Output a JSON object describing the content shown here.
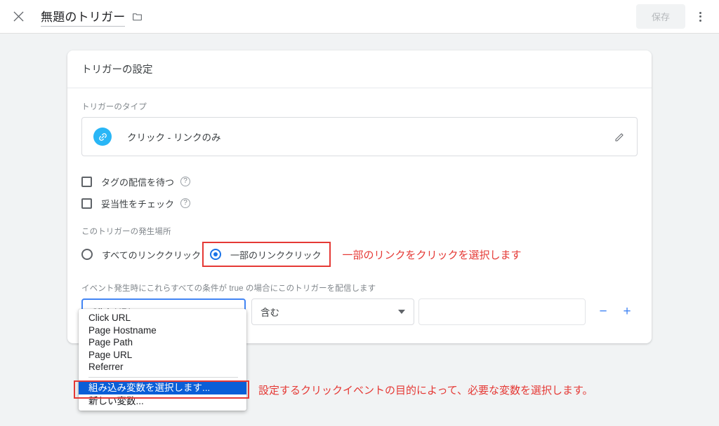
{
  "appbar": {
    "close_icon": "close-icon",
    "title": "無題のトリガー",
    "folder_icon": "folder-icon",
    "save_label": "保存",
    "overflow_icon": "more-vert-icon"
  },
  "card": {
    "heading": "トリガーの設定",
    "trigger_type": {
      "label": "トリガーのタイプ",
      "icon": "link-icon",
      "value": "クリック - リンクのみ",
      "edit_icon": "pencil-icon"
    },
    "checkboxes": [
      {
        "label": "タグの配信を待つ",
        "checked": false,
        "help_icon": "help-circle-icon"
      },
      {
        "label": "妥当性をチェック",
        "checked": false,
        "help_icon": "help-circle-icon"
      }
    ],
    "fire_on": {
      "label": "このトリガーの発生場所",
      "options": [
        {
          "label": "すべてのリンククリック",
          "selected": false
        },
        {
          "label": "一部のリンククリック",
          "selected": true
        }
      ]
    },
    "conditions": {
      "label": "イベント発生時にこれらすべての条件が true の場合にこのトリガーを配信します",
      "variable_value": "Click URL",
      "operator_value": "含む",
      "value_field": "",
      "remove_label": "−",
      "add_label": "+"
    }
  },
  "dropdown": {
    "items": [
      {
        "label": "Click URL",
        "selected": false
      },
      {
        "label": "Page Hostname",
        "selected": false
      },
      {
        "label": "Page Path",
        "selected": false
      },
      {
        "label": "Page URL",
        "selected": false
      },
      {
        "label": "Referrer",
        "selected": false
      }
    ],
    "footer_items": [
      {
        "label": "組み込み変数を選択します...",
        "selected": true
      },
      {
        "label": "新しい変数...",
        "selected": false
      }
    ]
  },
  "annotations": {
    "radio_note": "一部のリンクをクリックを選択します",
    "menu_note": "設定するクリックイベントの目的によって、必要な変数を選択します。",
    "color": "#e53935"
  },
  "colors": {
    "accent_blue": "#1a73e8",
    "focus_blue": "#4285f4",
    "menu_highlight": "#0a5ed7",
    "link_badge": "#29b6f6",
    "page_bg": "#f1f3f4"
  }
}
